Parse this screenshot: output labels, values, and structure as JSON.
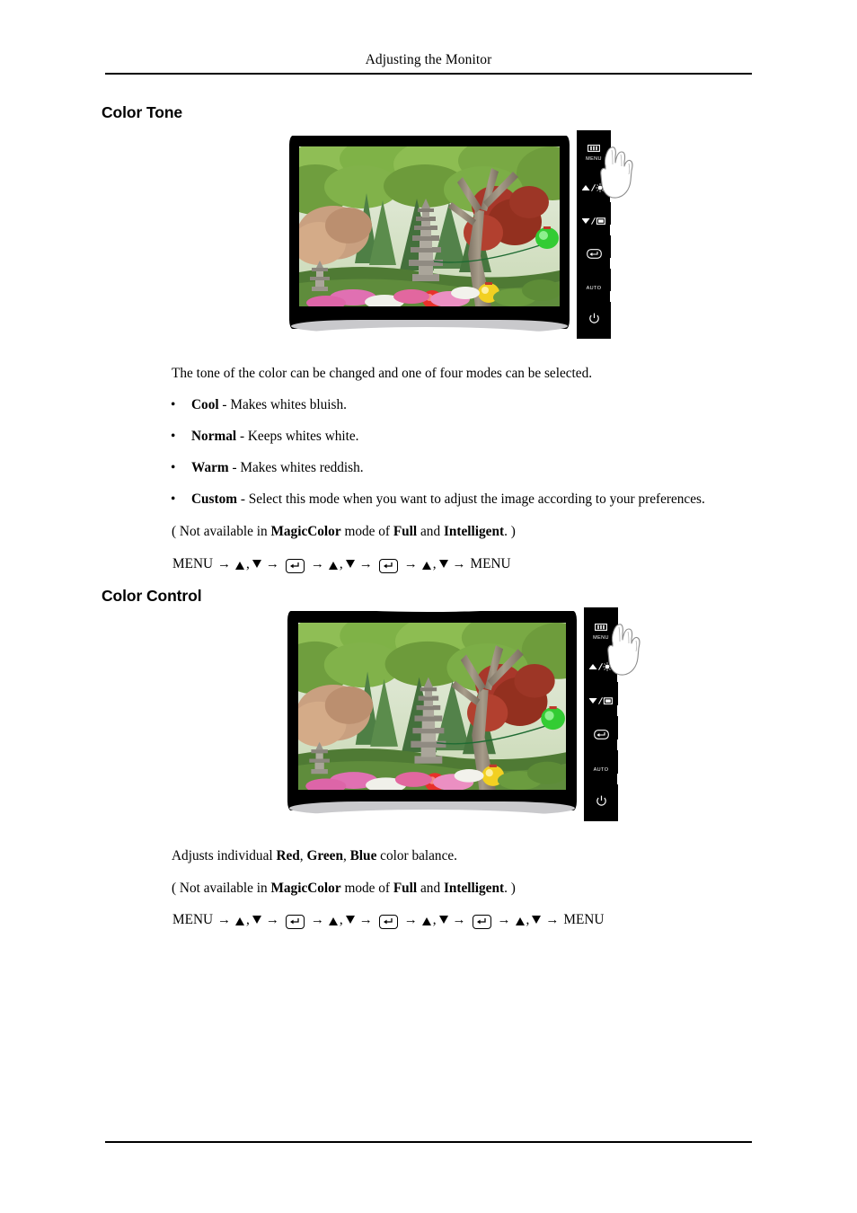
{
  "page": {
    "running_head": "Adjusting the Monitor"
  },
  "sections": [
    {
      "heading": "Color Tone",
      "intro": "The tone of the color can be changed and one of four modes can be selected.",
      "bullets": [
        {
          "term": "Cool",
          "desc": " - Makes whites bluish."
        },
        {
          "term": "Normal",
          "desc": " - Keeps whites white."
        },
        {
          "term": "Warm",
          "desc": " - Makes whites reddish."
        },
        {
          "term": "Custom",
          "desc": " - Select this mode when you want to adjust the image according to your preferences."
        }
      ],
      "note": {
        "prefix": "( Not available in ",
        "bold1": "MagicColor",
        "mid1": " mode of ",
        "bold2": "Full",
        "mid2": " and ",
        "bold3": "Intelligent",
        "suffix": ". )"
      },
      "nav": {
        "start": "MENU",
        "end": "MENU",
        "enter_count": 2
      }
    },
    {
      "heading": "Color Control",
      "intro_parts": {
        "prefix": "Adjusts individual ",
        "bold1": "Red",
        "sep1": ", ",
        "bold2": "Green",
        "sep2": ", ",
        "bold3": "Blue",
        "suffix": " color balance."
      },
      "note": {
        "prefix": "( Not available in ",
        "bold1": "MagicColor",
        "mid1": " mode of ",
        "bold2": "Full",
        "mid2": " and ",
        "bold3": "Intelligent",
        "suffix": ". )"
      },
      "nav": {
        "start": "MENU",
        "end": "MENU",
        "enter_count": 3
      }
    }
  ],
  "monitor": {
    "control_buttons": [
      {
        "name": "menu",
        "label": "MENU",
        "icon": "menu-bars-icon"
      },
      {
        "name": "up-brightness",
        "label": "",
        "icon": "up-brightness-icon"
      },
      {
        "name": "down-source",
        "label": "",
        "icon": "down-source-icon"
      },
      {
        "name": "enter",
        "label": "",
        "icon": "enter-icon"
      },
      {
        "name": "auto",
        "label": "AUTO",
        "icon": "auto-label"
      },
      {
        "name": "power",
        "label": "",
        "icon": "power-icon"
      }
    ],
    "screen_scene": "korean-garden-with-stone-pagoda-and-lanterns",
    "hand_cursor": "pointing-hand-illustration",
    "colors": {
      "bezel": "#000000",
      "shadow": "#b8b8bb",
      "foliage_light": "#8cc152",
      "foliage_dark": "#2f5d1e",
      "trunk": "#9b8f7e",
      "lantern_green": "#33cc33",
      "lantern_red": "#e8312a",
      "lantern_yellow": "#f2d022",
      "flowers_pink": "#e86ab0"
    }
  }
}
